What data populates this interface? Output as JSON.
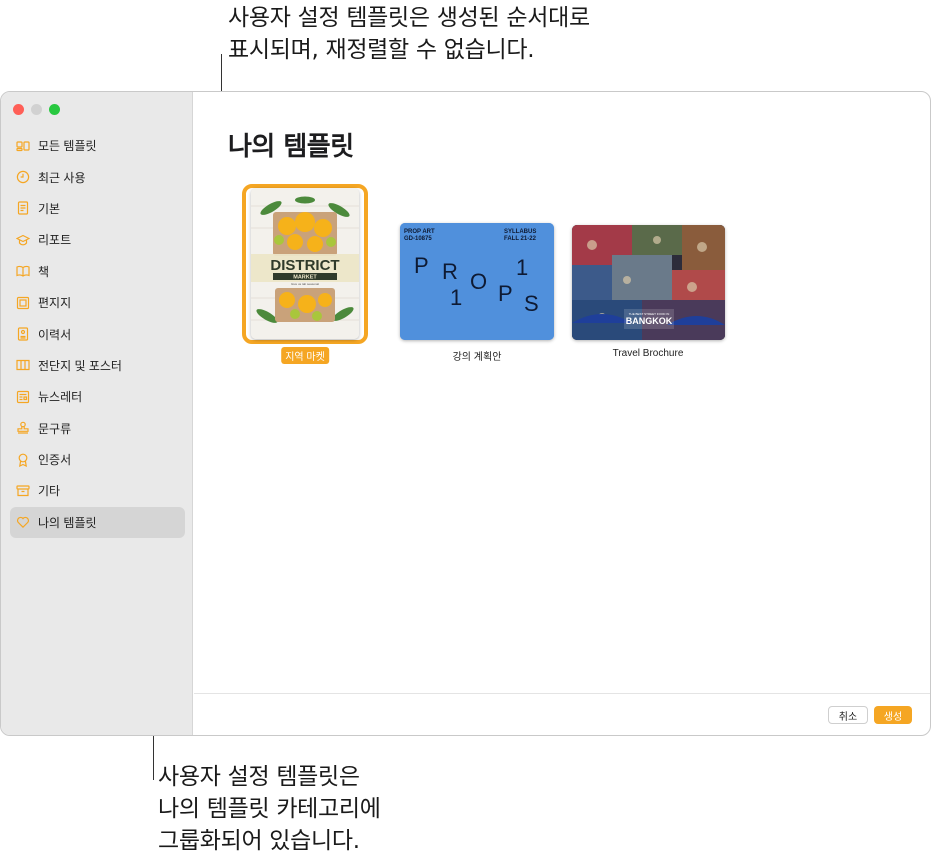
{
  "callouts": {
    "top": [
      "사용자 설정 템플릿은 생성된 순서대로",
      "표시되며, 재정렬할 수 없습니다."
    ],
    "bottom": [
      "사용자 설정 템플릿은",
      "나의 템플릿 카테고리에",
      "그룹화되어 있습니다."
    ]
  },
  "sidebar": {
    "items": [
      {
        "label": "모든 템플릿",
        "icon": "all-templates-icon",
        "selected": false
      },
      {
        "label": "최근 사용",
        "icon": "clock-icon",
        "selected": false
      },
      {
        "label": "기본",
        "icon": "document-icon",
        "selected": false
      },
      {
        "label": "리포트",
        "icon": "graduation-cap-icon",
        "selected": false
      },
      {
        "label": "책",
        "icon": "book-icon",
        "selected": false
      },
      {
        "label": "편지지",
        "icon": "stationery-icon",
        "selected": false
      },
      {
        "label": "이력서",
        "icon": "resume-icon",
        "selected": false
      },
      {
        "label": "전단지 및 포스터",
        "icon": "flyer-icon",
        "selected": false
      },
      {
        "label": "뉴스레터",
        "icon": "newsletter-icon",
        "selected": false
      },
      {
        "label": "문구류",
        "icon": "stamp-icon",
        "selected": false
      },
      {
        "label": "인증서",
        "icon": "ribbon-icon",
        "selected": false
      },
      {
        "label": "기타",
        "icon": "archive-box-icon",
        "selected": false
      },
      {
        "label": "나의 템플릿",
        "icon": "heart-icon",
        "selected": true
      }
    ]
  },
  "main": {
    "title": "나의 템플릿",
    "templates": [
      {
        "label": "지역 마켓",
        "selected": true,
        "thumb_text": {
          "line1": "DISTRICT",
          "line2": "MARKET",
          "sub": "Give us tab seasonal"
        }
      },
      {
        "label": "강의 계획안",
        "selected": false,
        "thumb_text": {
          "tl1": "PROP ART",
          "tl2": "GD-10875",
          "tr1": "SYLLABUS",
          "tr2": "FALL 21-22",
          "letters": [
            "P",
            "R",
            "O",
            "P",
            "S"
          ],
          "digits": [
            "1",
            "1"
          ]
        }
      },
      {
        "label": "Travel Brochure",
        "selected": false,
        "thumb_text": {
          "small": "THE BEST STREET FOOD IN",
          "big": "BANGKOK"
        }
      }
    ]
  },
  "footer": {
    "cancel_label": "취소",
    "create_label": "생성"
  },
  "colors": {
    "accent": "#f5a623",
    "sidebar_bg": "#e9e9e9",
    "syllabus_blue": "#5090dc"
  }
}
